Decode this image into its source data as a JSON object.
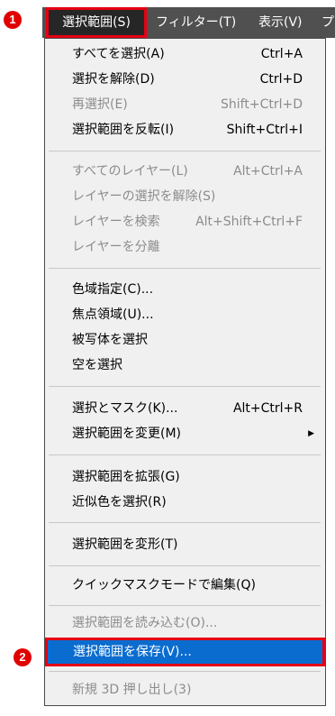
{
  "markers": {
    "menubar": "1",
    "save_item": "2"
  },
  "menubar": {
    "items": [
      {
        "label": "選択範囲(S)"
      },
      {
        "label": "フィルター(T)"
      },
      {
        "label": "表示(V)"
      },
      {
        "label": "プ"
      }
    ]
  },
  "menu": {
    "items": [
      {
        "label": "すべてを選択(A)",
        "shortcut": "Ctrl+A"
      },
      {
        "label": "選択を解除(D)",
        "shortcut": "Ctrl+D"
      },
      {
        "label": "再選択(E)",
        "shortcut": "Shift+Ctrl+D"
      },
      {
        "label": "選択範囲を反転(I)",
        "shortcut": "Shift+Ctrl+I"
      },
      {
        "label": "すべてのレイヤー(L)",
        "shortcut": "Alt+Ctrl+A"
      },
      {
        "label": "レイヤーの選択を解除(S)"
      },
      {
        "label": "レイヤーを検索",
        "shortcut": "Alt+Shift+Ctrl+F"
      },
      {
        "label": "レイヤーを分離"
      },
      {
        "label": "色域指定(C)..."
      },
      {
        "label": "焦点領域(U)..."
      },
      {
        "label": "被写体を選択"
      },
      {
        "label": "空を選択"
      },
      {
        "label": "選択とマスク(K)...",
        "shortcut": "Alt+Ctrl+R"
      },
      {
        "label": "選択範囲を変更(M)"
      },
      {
        "label": "選択範囲を拡張(G)"
      },
      {
        "label": "近似色を選択(R)"
      },
      {
        "label": "選択範囲を変形(T)"
      },
      {
        "label": "クイックマスクモードで編集(Q)"
      },
      {
        "label": "選択範囲を読み込む(O)..."
      },
      {
        "label": "選択範囲を保存(V)..."
      },
      {
        "label": "新規 3D 押し出し(3)"
      }
    ]
  },
  "colors": {
    "accent_red": "#e60012",
    "highlight_blue": "#0a6ccf",
    "menubar_bg": "#505050"
  }
}
